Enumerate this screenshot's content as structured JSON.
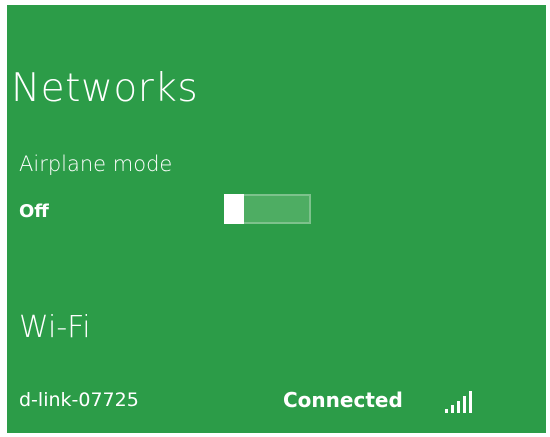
{
  "panel": {
    "title": "Networks",
    "background_color": "#2c9c48"
  },
  "airplane_mode": {
    "label": "Airplane mode",
    "state": "Off",
    "toggle_on": false
  },
  "wifi": {
    "title": "Wi-Fi",
    "networks": [
      {
        "name": "d-link-07725",
        "status": "Connected",
        "icon": "wifi-signal-icon",
        "signal_bars": 5
      }
    ]
  }
}
